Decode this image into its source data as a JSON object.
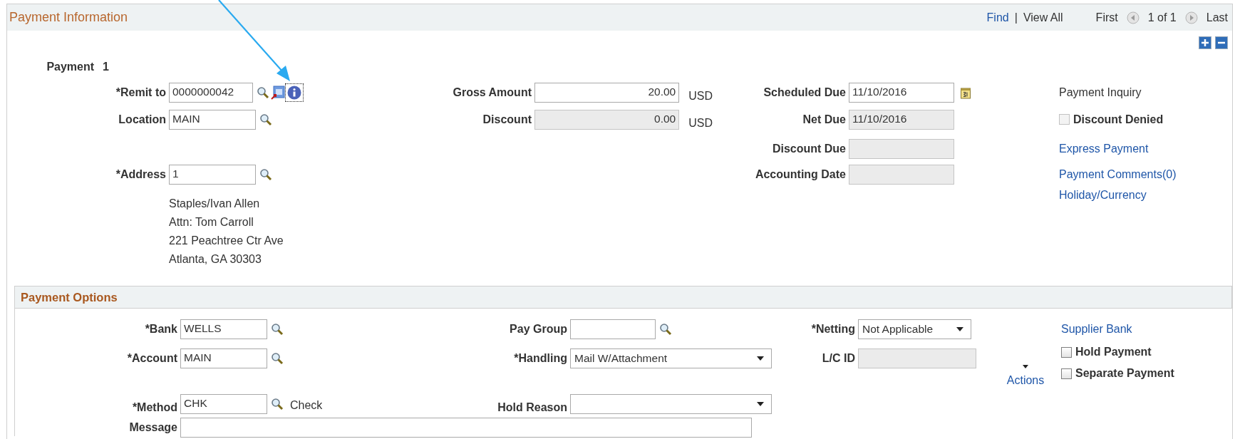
{
  "header": {
    "title": "Payment Information",
    "find": "Find",
    "separator": "|",
    "view_all": "View All",
    "first": "First",
    "count": "1 of 1",
    "last": "Last"
  },
  "payment": {
    "label": "Payment",
    "number": "1"
  },
  "left_fields": [
    {
      "label": "*Remit to",
      "value": "0000000042",
      "kind": "remit"
    },
    {
      "label": "Location",
      "value": "MAIN",
      "kind": "lookup"
    },
    {
      "label": "*Address",
      "value": "1",
      "kind": "lookup"
    }
  ],
  "address_lines": [
    "Staples/Ivan Allen",
    "Attn: Tom Carroll",
    "221 Peachtree Ctr Ave",
    "Atlanta, GA  30303"
  ],
  "amount_fields": [
    {
      "label": "Gross Amount",
      "value": "20.00",
      "currency": "USD",
      "disabled": false
    },
    {
      "label": "Discount",
      "value": "0.00",
      "currency": "USD",
      "disabled": true
    }
  ],
  "date_fields": [
    {
      "label": "Scheduled Due",
      "value": "11/10/2016",
      "disabled": false,
      "calendar": true
    },
    {
      "label": "Net Due",
      "value": "11/10/2016",
      "disabled": true,
      "calendar": false
    },
    {
      "label": "Discount Due",
      "disabled": true,
      "calendar": false
    },
    {
      "label": "Accounting Date",
      "disabled": true,
      "calendar": false
    }
  ],
  "side": {
    "inquiry_label": "Payment Inquiry",
    "checkbox": {
      "label": "Discount Denied",
      "checked": false,
      "disabled": true
    },
    "links": [
      "Express Payment",
      "Payment Comments(0)",
      "Holiday/Currency"
    ]
  },
  "options": {
    "title": "Payment Options",
    "bank": {
      "label": "*Bank",
      "value": "WELLS"
    },
    "account": {
      "label": "*Account",
      "value": "MAIN"
    },
    "method": {
      "label": "*Method",
      "value": "CHK",
      "description": "Check"
    },
    "message": {
      "label": "Message"
    },
    "pay_group": {
      "label": "Pay Group"
    },
    "handling": {
      "label": "*Handling",
      "value": "Mail W/Attachment"
    },
    "hold_reason": {
      "label": "Hold Reason"
    },
    "netting": {
      "label": "*Netting",
      "value": "Not Applicable"
    },
    "lc_id": {
      "label": "L/C ID",
      "disabled": true
    },
    "supplier_bank": "Supplier Bank",
    "actions": "Actions",
    "checkboxes": [
      {
        "label": "Hold Payment",
        "checked": false
      },
      {
        "label": "Separate Payment",
        "checked": false
      }
    ]
  }
}
